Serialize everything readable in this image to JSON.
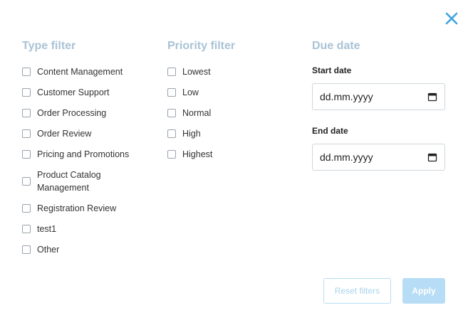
{
  "close": {
    "icon": "close-icon",
    "color": "#3fa4e0"
  },
  "type_filter": {
    "title": "Type filter",
    "options": [
      "Content Management",
      "Customer Support",
      "Order Processing",
      "Order Review",
      "Pricing and Promotions",
      "Product Catalog Management",
      "Registration Review",
      "test1",
      "Other"
    ]
  },
  "priority_filter": {
    "title": "Priority filter",
    "options": [
      "Lowest",
      "Low",
      "Normal",
      "High",
      "Highest"
    ]
  },
  "due_date": {
    "title": "Due date",
    "start_label": "Start date",
    "start_value": "dd.mm.yyyy",
    "end_label": "End date",
    "end_value": "dd.mm.yyyy"
  },
  "buttons": {
    "reset": "Reset filters",
    "apply": "Apply"
  },
  "colors": {
    "accent": "#3fa4e0",
    "section_title": "#a9c3d6",
    "button_disabled": "#b6ddf5"
  }
}
